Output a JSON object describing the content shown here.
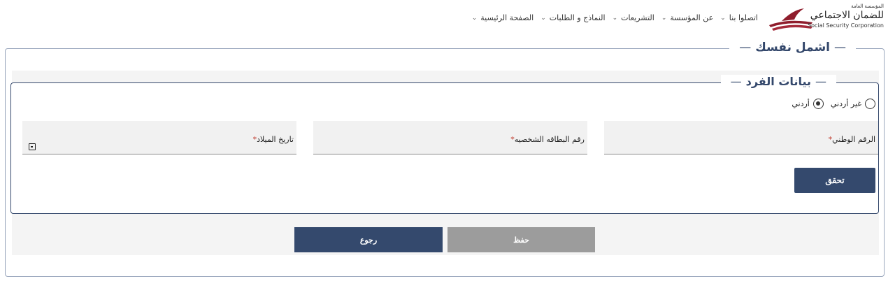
{
  "header": {
    "logo": {
      "small_text": "المؤسسة العامة",
      "big_text": "للضمان الاجتماعي",
      "english_text": "Social Security Corporation"
    },
    "nav": [
      {
        "label": "الصفحة الرئيسية"
      },
      {
        "label": "النماذج و الطلبات"
      },
      {
        "label": "التشريعات"
      },
      {
        "label": "عن المؤسسة"
      },
      {
        "label": "اتصلوا بنا"
      }
    ],
    "chevron_icon": "chevron-down-icon"
  },
  "page": {
    "title": "اشمل نفسك"
  },
  "individual": {
    "title": "بيانات الفرد",
    "nationality_options": [
      {
        "label": "أردني",
        "checked": true
      },
      {
        "label": "غير أردني",
        "checked": false
      }
    ],
    "fields": {
      "national_id": {
        "label": "الرقم الوطني",
        "value": ""
      },
      "id_card_number": {
        "label": "رقم البطاقه الشخصيه",
        "value": ""
      },
      "birth_date": {
        "label": "تاريخ الميلاد",
        "value": ""
      }
    },
    "required_mark": "*",
    "verify_label": "تحقق"
  },
  "actions": {
    "save_label": "حفظ",
    "back_label": "رجوع"
  },
  "colors": {
    "primary": "#34496d",
    "disabled": "#9c9c9c",
    "required": "#c0392b"
  }
}
